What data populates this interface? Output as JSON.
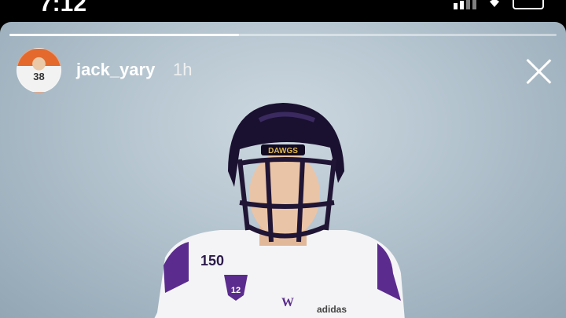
{
  "status_bar": {
    "time": "7:12"
  },
  "story": {
    "progress": 0.42,
    "username": "jack_yary",
    "time_ago": "1h",
    "avatar_number": "38"
  },
  "photo": {
    "helmet_text": "DAWGS",
    "patch_text": "150",
    "conference_text": "12",
    "logo_text": "W",
    "brand_text": "adidas"
  }
}
